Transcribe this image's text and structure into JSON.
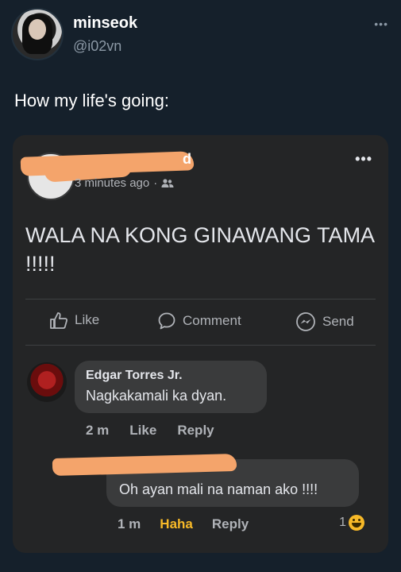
{
  "tweet": {
    "display_name": "minseok",
    "handle": "@i02vn",
    "more_icon": "more-horizontal-icon",
    "text": "How my life's going:"
  },
  "fb_post": {
    "author_name_visible_tail": "d",
    "time": "3 minutes ago",
    "separator": "·",
    "audience_icon": "friends-icon",
    "more_icon": "more-horizontal-icon",
    "body": "WALA NA KONG GINAWANG TAMA !!!!!",
    "actions": {
      "like": "Like",
      "comment": "Comment",
      "send": "Send"
    },
    "comments": [
      {
        "author": "Edgar Torres Jr.",
        "text": "Nagkakamali ka dyan.",
        "time": "2 m",
        "like": "Like",
        "reply": "Reply"
      },
      {
        "text": "Oh ayan mali na naman ako !!!!",
        "time": "1 m",
        "reaction": "Haha",
        "reply": "Reply",
        "reaction_count": "1"
      }
    ]
  },
  "colors": {
    "background": "#15202b",
    "card": "#242526",
    "bubble": "#3a3b3c",
    "redaction": "#f4a46b",
    "haha": "#f7b928"
  }
}
